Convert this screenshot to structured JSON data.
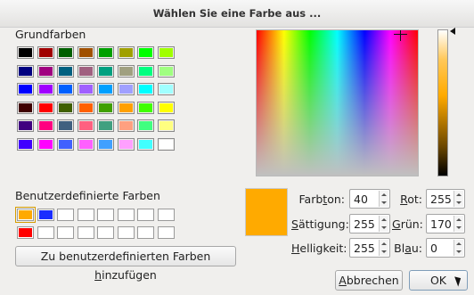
{
  "window": {
    "title": "Wählen Sie eine Farbe aus ..."
  },
  "basic_colors": {
    "label": "Grundfarben",
    "rows": [
      [
        "#000000",
        "#a00000",
        "#006000",
        "#a05000",
        "#00a000",
        "#a0a000",
        "#00ff00",
        "#a0ff00"
      ],
      [
        "#000080",
        "#a00080",
        "#006080",
        "#a06080",
        "#00a080",
        "#a0a080",
        "#00ff80",
        "#a0ff80"
      ],
      [
        "#0000ff",
        "#a000ff",
        "#0060ff",
        "#a060ff",
        "#00a0ff",
        "#a0a0ff",
        "#00ffff",
        "#a0ffff"
      ],
      [
        "#400000",
        "#ff0000",
        "#406000",
        "#ff6000",
        "#40a000",
        "#ffa000",
        "#40ff00",
        "#ffff00"
      ],
      [
        "#400080",
        "#ff0080",
        "#406080",
        "#ff6080",
        "#40a080",
        "#ffa080",
        "#40ff80",
        "#ffff80"
      ],
      [
        "#4000ff",
        "#ff00ff",
        "#4060ff",
        "#ff60ff",
        "#40a0ff",
        "#ffa0ff",
        "#40ffff",
        "#ffffff"
      ]
    ]
  },
  "custom_colors": {
    "label": "Benutzerdefinierte Farben",
    "rows": [
      [
        "#ffaa00",
        "#1a2dff",
        "#ffffff",
        "#ffffff",
        "#ffffff",
        "#ffffff",
        "#ffffff",
        "#ffffff"
      ],
      [
        "#ff0000",
        "#ffffff",
        "#ffffff",
        "#ffffff",
        "#ffffff",
        "#ffffff",
        "#ffffff",
        "#ffffff"
      ]
    ]
  },
  "add_custom_button": {
    "pre": "Zu benutzerdefinierten Farben ",
    "key": "h",
    "post": "inzufügen"
  },
  "preview": {
    "color": "#ffaa00"
  },
  "fields": {
    "hue": {
      "pre": "Farb",
      "key": "t",
      "post": "on:",
      "value": "40"
    },
    "saturation": {
      "pre": "",
      "key": "S",
      "post": "ättigung:",
      "value": "255"
    },
    "value": {
      "pre": "",
      "key": "H",
      "post": "elligkeit:",
      "value": "255"
    },
    "red": {
      "pre": "",
      "key": "R",
      "post": "ot:",
      "value": "255"
    },
    "green": {
      "pre": "",
      "key": "G",
      "post": "rün:",
      "value": "170"
    },
    "blue": {
      "pre": "Bl",
      "key": "a",
      "post": "u:",
      "value": "0"
    }
  },
  "buttons": {
    "cancel": {
      "pre": "",
      "key": "A",
      "post": "bbrechen"
    },
    "ok": {
      "label": "OK"
    }
  }
}
